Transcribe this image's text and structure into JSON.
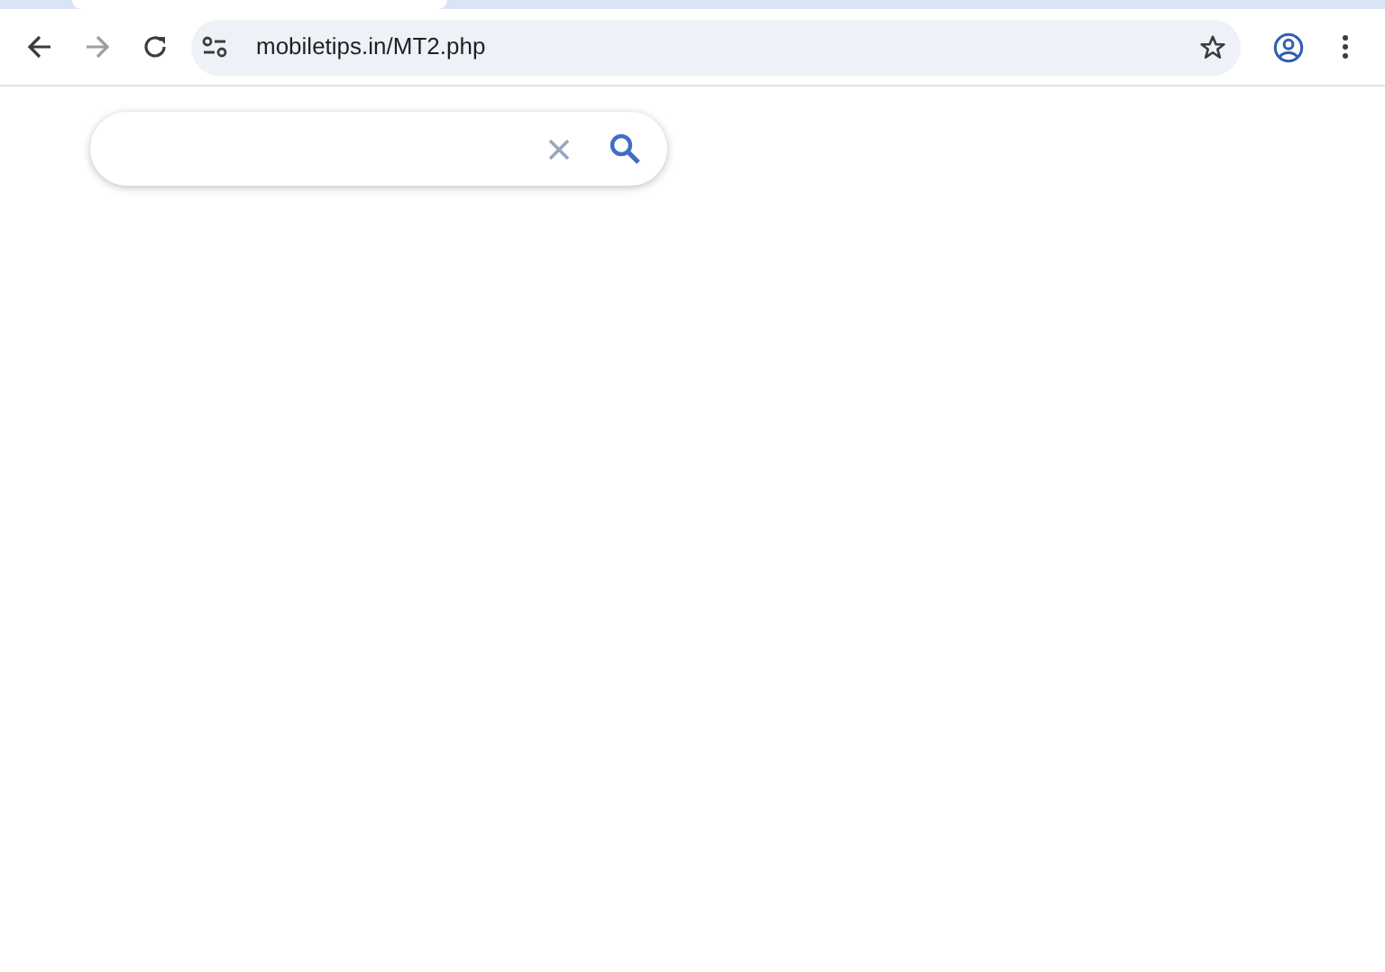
{
  "browser": {
    "address": "mobiletips.in/MT2.php",
    "forward_disabled": true
  }
}
